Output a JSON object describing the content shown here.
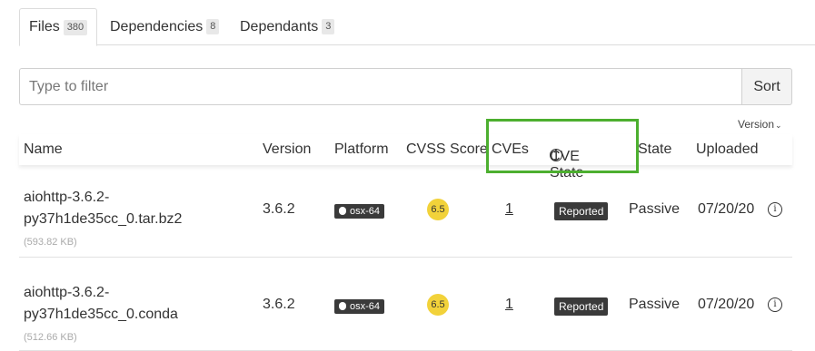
{
  "tabs": [
    {
      "label": "Files",
      "count": "380"
    },
    {
      "label": "Dependencies",
      "count": "8"
    },
    {
      "label": "Dependants",
      "count": "3"
    }
  ],
  "filter": {
    "placeholder": "Type to filter",
    "sort_label": "Sort"
  },
  "version_sort": {
    "label": "Version",
    "icon": "chevron-down-icon"
  },
  "columns": [
    "Name",
    "Version",
    "Platform",
    "CVSS Score",
    "CVEs",
    "CVE State",
    "State",
    "Uploaded"
  ],
  "highlight_color": "#4caf2f",
  "rows": [
    {
      "name_line1": "aiohttp-3.6.2-",
      "name_line2": "py37h1de35cc_0.tar.bz2",
      "size": "(593.82 KB)",
      "version": "3.6.2",
      "platform": "osx-64",
      "cvss": "6.5",
      "cves": "1",
      "cve_state": "Reported",
      "state": "Passive",
      "uploaded": "07/20/20"
    },
    {
      "name_line1": "aiohttp-3.6.2-",
      "name_line2": "py37h1de35cc_0.conda",
      "size": "(512.66 KB)",
      "version": "3.6.2",
      "platform": "osx-64",
      "cvss": "6.5",
      "cves": "1",
      "cve_state": "Reported",
      "state": "Passive",
      "uploaded": "07/20/20"
    }
  ]
}
